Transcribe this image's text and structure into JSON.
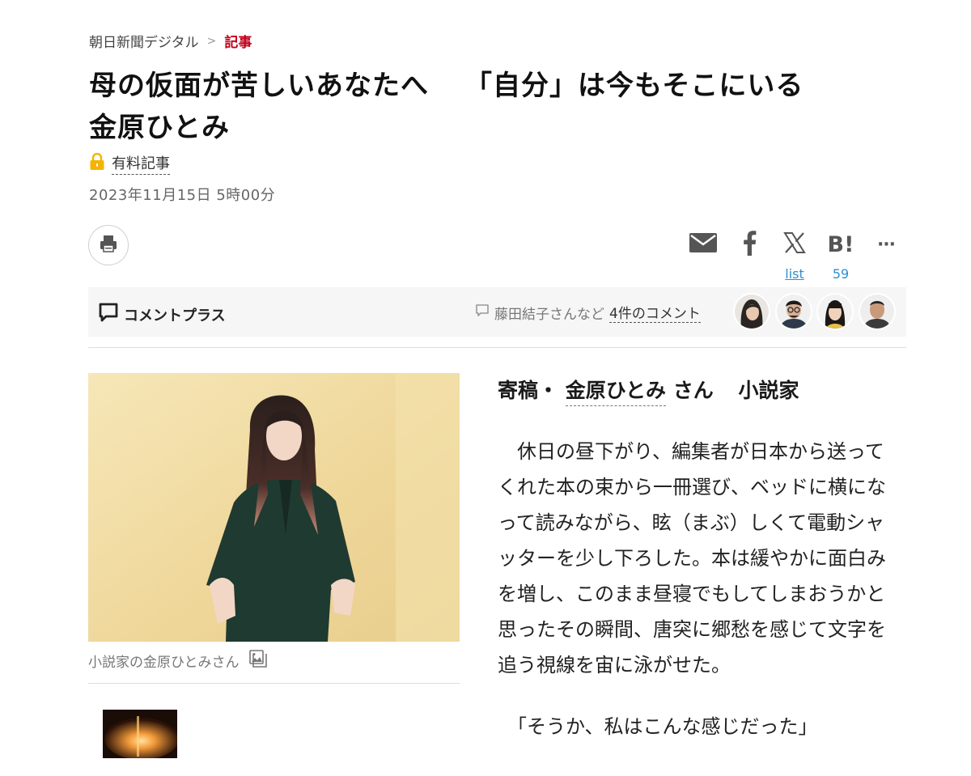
{
  "breadcrumb": {
    "site": "朝日新聞デジタル",
    "separator": ">",
    "current": "記事"
  },
  "article": {
    "title_line1_a": "母の仮面が苦しいあなたへ",
    "title_line1_b": "「自分」は今もそこにいる",
    "title_line2": "金原ひとみ",
    "paid_label": "有料記事",
    "date": "2023年11月15日 5時00分"
  },
  "share": {
    "list_label": "list",
    "hatena_count": "59",
    "hatena_label": "B!",
    "more_label": "···"
  },
  "comment_plus": {
    "title": "コメントプラス",
    "commenter": "藤田結子さんなど",
    "count_label": "4件のコメント"
  },
  "photo": {
    "caption": "小説家の金原ひとみさん"
  },
  "byline": {
    "prefix": "寄稿・",
    "author": "金原ひとみ",
    "honorific": "さん",
    "role": "小説家"
  },
  "body": {
    "lines": [
      "　休日の昼下がり、編集者が日本から送って",
      "くれた本の束から一冊選び、ベッドに横にな",
      "って読みながら、眩（まぶ）しくて電動シャ",
      "ッターを少し下ろした。本は緩やかに面白み",
      "を増し、このまま昼寝でもしてしまおうかと",
      "思ったその瞬間、唐突に郷愁を感じて文字を",
      "追う視線を宙に泳がせた。"
    ],
    "quote": "　「そうか、私はこんな感じだった」"
  },
  "colors": {
    "accent_red": "#c4001a",
    "link_blue": "#2a8fd6",
    "lock_yellow": "#f4b400"
  },
  "icons": {
    "print": "printer-icon",
    "mail": "mail-icon",
    "facebook": "facebook-icon",
    "x": "x-icon",
    "hatena": "hatena-bookmark-icon",
    "more": "more-icon",
    "comment": "comment-bubble-icon",
    "lock": "lock-icon",
    "gallery": "gallery-icon"
  }
}
